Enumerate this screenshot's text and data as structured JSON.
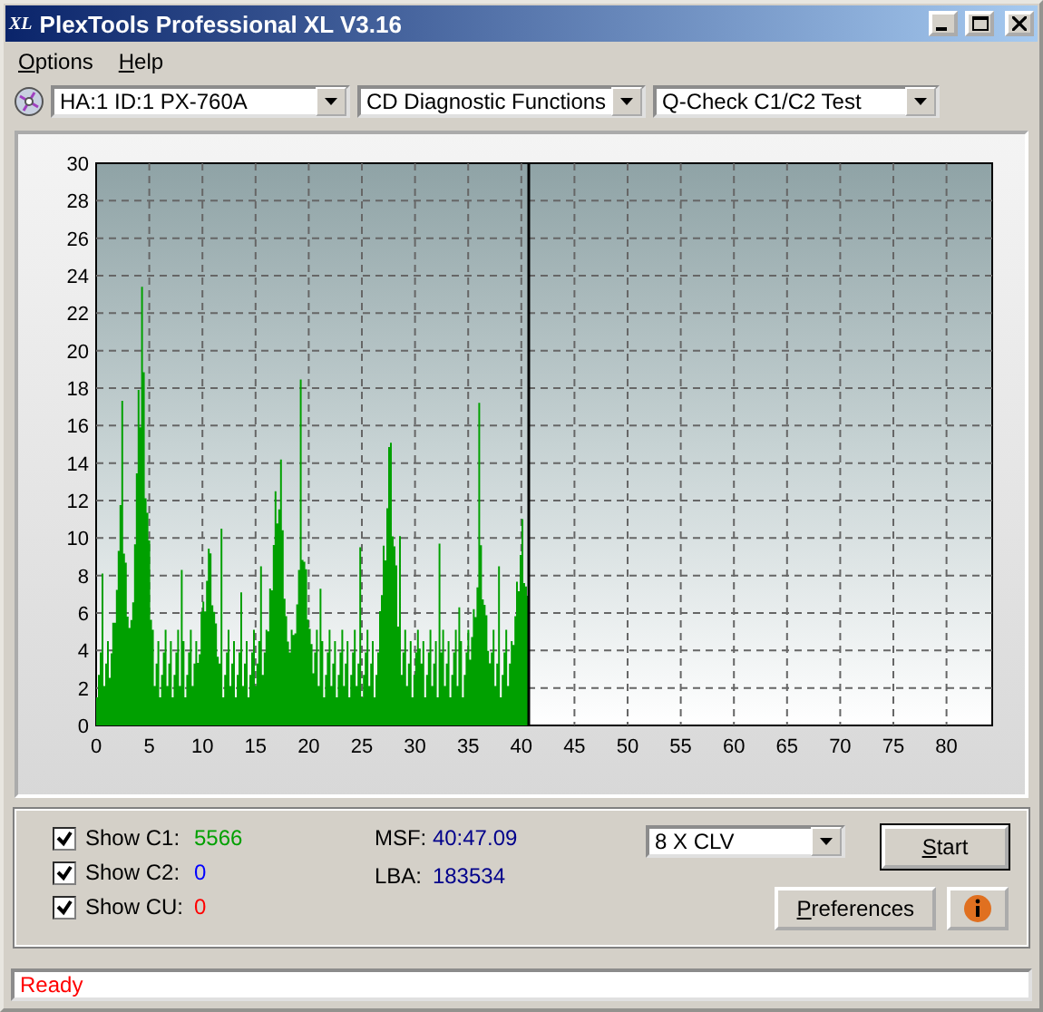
{
  "window": {
    "title": "PlexTools Professional XL V3.16",
    "logo": "XL"
  },
  "menu": [
    {
      "label": "Options"
    },
    {
      "label": "Help"
    }
  ],
  "selectors": [
    {
      "value": "HA:1 ID:1  PX-760A"
    },
    {
      "value": "CD Diagnostic Functions"
    },
    {
      "value": "Q-Check C1/C2 Test"
    }
  ],
  "chart": {
    "y_labels": [
      "30",
      "28",
      "26",
      "24",
      "22",
      "20",
      "18",
      "16",
      "14",
      "12",
      "10",
      "8",
      "6",
      "4",
      "2",
      "0"
    ],
    "x_labels": [
      "0",
      "5",
      "10",
      "15",
      "20",
      "25",
      "30",
      "35",
      "40",
      "45",
      "50",
      "55",
      "60",
      "65",
      "70",
      "75",
      "80"
    ]
  },
  "counters": [
    {
      "label": "Show C1:",
      "checked": true,
      "value": "5566",
      "color": "#00a000"
    },
    {
      "label": "Show C2:",
      "checked": true,
      "value": "0",
      "color": "#0000ff"
    },
    {
      "label": "Show CU:",
      "checked": true,
      "value": "0",
      "color": "#ff0000"
    }
  ],
  "position": [
    {
      "label": "MSF:",
      "value": "40:47.09"
    },
    {
      "label": "LBA:",
      "value": "183534"
    }
  ],
  "speed": {
    "value": "8 X CLV"
  },
  "buttons": {
    "start": {
      "label": "Start"
    },
    "preferences": {
      "label": "Preferences"
    }
  },
  "status_bar": {
    "text": "Ready"
  }
}
